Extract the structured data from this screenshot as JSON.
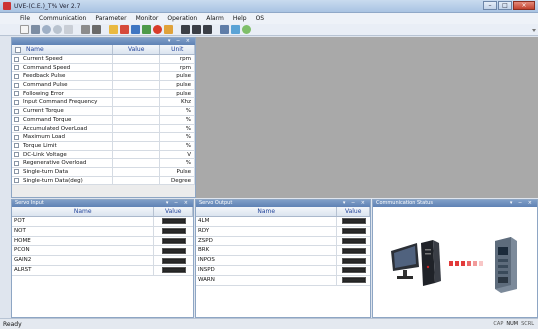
{
  "window": {
    "title": "UVE-(C.E.)_T% Ver 2.7"
  },
  "menu": [
    "File",
    "Communication",
    "Parameter",
    "Monitor",
    "Operation",
    "Alarm",
    "Help",
    "OS"
  ],
  "monitor": {
    "headers": {
      "name": "Name",
      "value": "Value",
      "unit": "Unit"
    },
    "rows": [
      {
        "name": "Current Speed",
        "value": "",
        "unit": "rpm"
      },
      {
        "name": "Command Speed",
        "value": "",
        "unit": "rpm"
      },
      {
        "name": "Feedback Pulse",
        "value": "",
        "unit": "pulse"
      },
      {
        "name": "Command Pulse",
        "value": "",
        "unit": "pulse"
      },
      {
        "name": "Following Error",
        "value": "",
        "unit": "pulse"
      },
      {
        "name": "Input Command Frequency",
        "value": "",
        "unit": "Khz"
      },
      {
        "name": "Current Torque",
        "value": "",
        "unit": "%"
      },
      {
        "name": "Command Torque",
        "value": "",
        "unit": "%"
      },
      {
        "name": "Accumulated OverLoad",
        "value": "",
        "unit": "%"
      },
      {
        "name": "Maximum Load",
        "value": "",
        "unit": "%"
      },
      {
        "name": "Torque Limit",
        "value": "",
        "unit": "%"
      },
      {
        "name": "DC-Link Voltage",
        "value": "",
        "unit": "V"
      },
      {
        "name": "Regenerative Overload",
        "value": "",
        "unit": "%"
      },
      {
        "name": "Single-turn Data",
        "value": "",
        "unit": "Pulse"
      },
      {
        "name": "Single-turn Data(deg)",
        "value": "",
        "unit": "Degree"
      }
    ]
  },
  "servo_input": {
    "title": "Servo Input",
    "headers": {
      "name": "Name",
      "value": "Value"
    },
    "rows": [
      "POT",
      "NOT",
      "HOME",
      "PCON",
      "GAIN2",
      "ALRST"
    ]
  },
  "servo_output": {
    "title": "Servo Output",
    "headers": {
      "name": "Name",
      "value": "Value"
    },
    "rows": [
      "4LM",
      "RDY",
      "ZSPD",
      "BRK",
      "INPOS",
      "INSPD",
      "WARN"
    ]
  },
  "communication_status": {
    "title": "Communication Status"
  },
  "panel_controls": "▾ − ×",
  "status": {
    "ready": "Ready",
    "indicators": [
      "CAP",
      "NUM",
      "SCRL"
    ],
    "active_indicator": "NUM"
  },
  "colors": {
    "accent": "#5f82b4",
    "workspace": "#a9a9a9",
    "led": "#2a2a2a",
    "link": "#e23a3a"
  }
}
